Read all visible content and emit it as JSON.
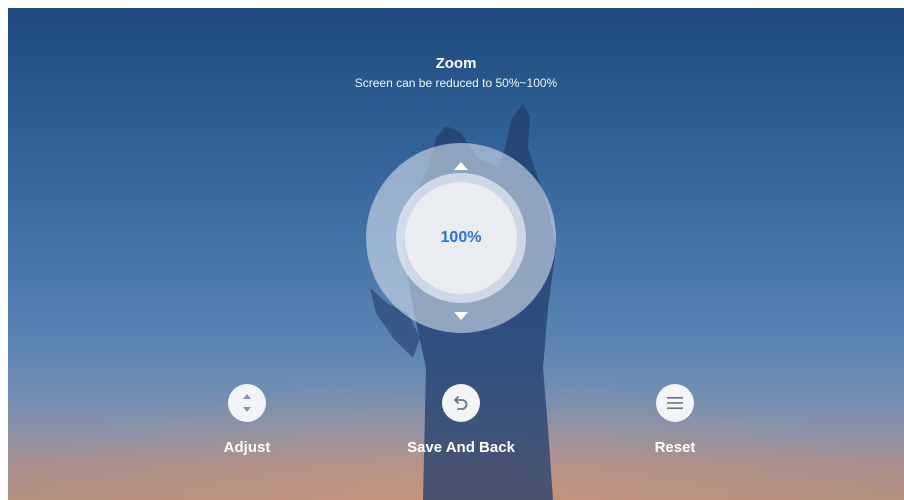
{
  "header": {
    "title": "Zoom",
    "subtitle": "Screen can be reduced to 50%~100%"
  },
  "dial": {
    "value_label": "100%",
    "value_percent": 100,
    "accent_color": "#2f6fd6"
  },
  "actions": [
    {
      "label": "Adjust",
      "icon": "up-down-arrows-icon"
    },
    {
      "label": "Save And Back",
      "icon": "undo-arrow-icon"
    },
    {
      "label": "Reset",
      "icon": "menu-lines-icon"
    }
  ]
}
